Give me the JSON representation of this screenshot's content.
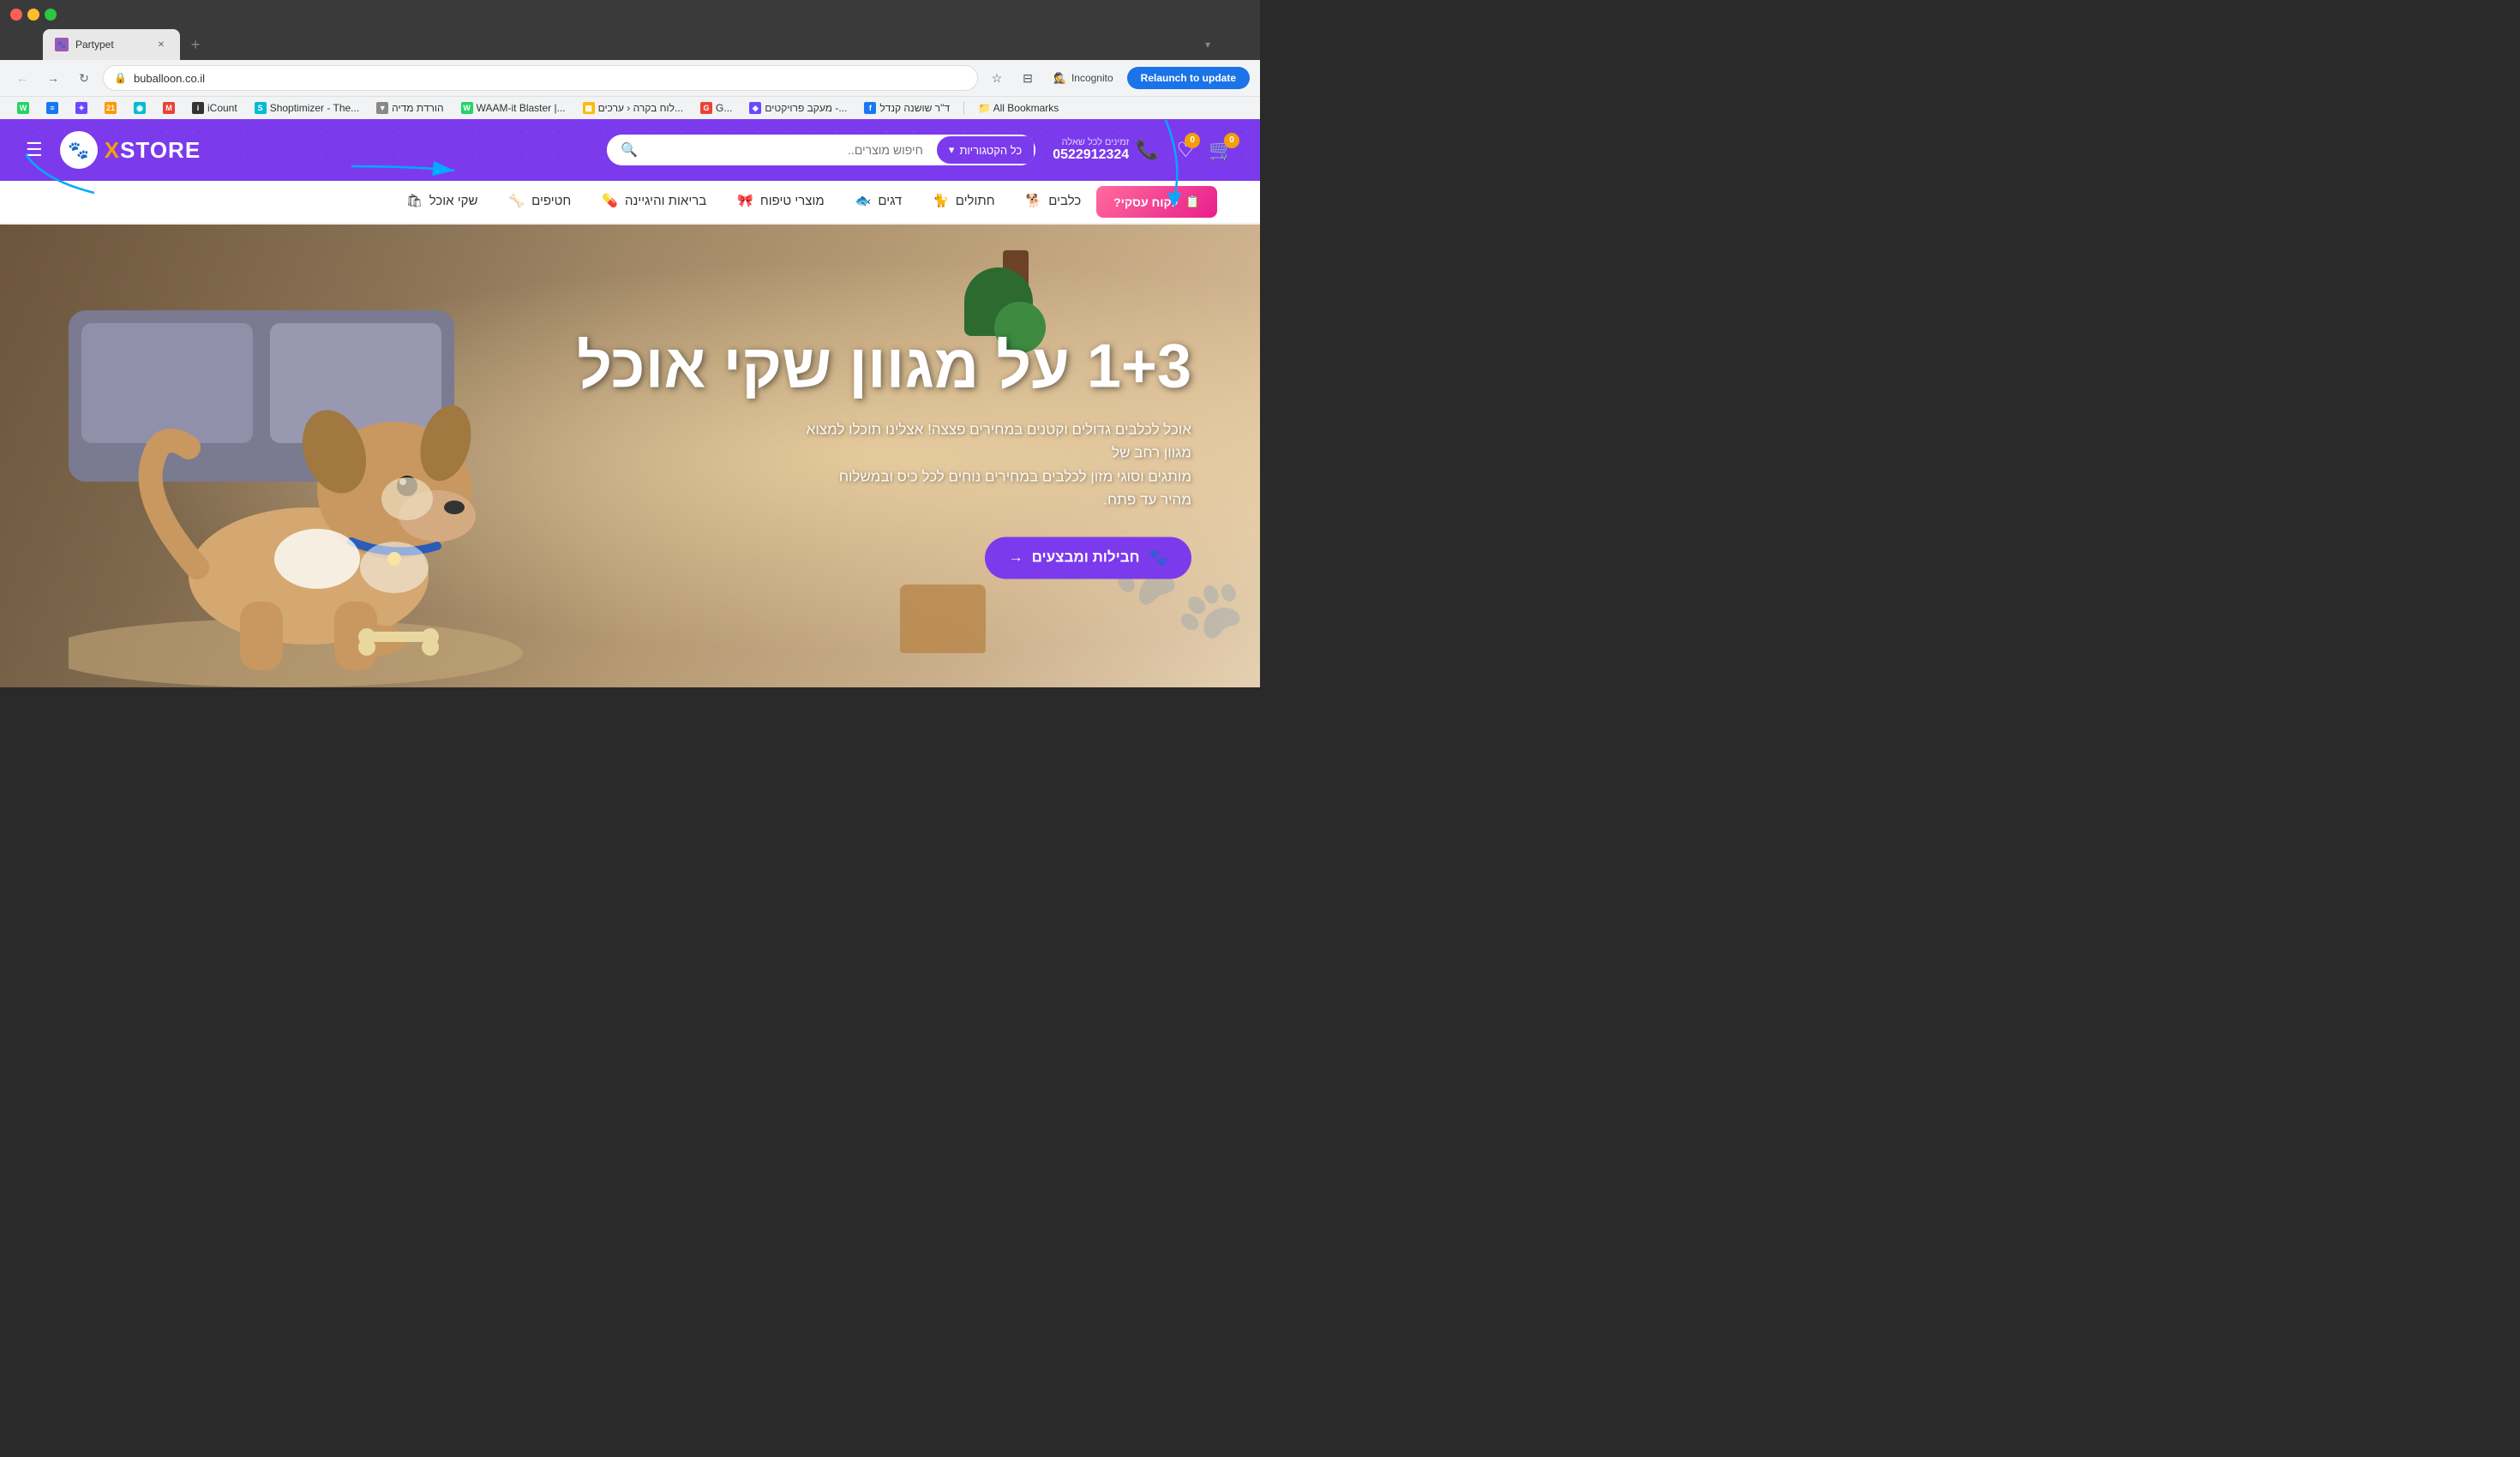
{
  "browser": {
    "tab_title": "Partypet",
    "url": "buballoon.co.il",
    "relaunch_btn": "Relaunch to update",
    "incognito_label": "Incognito",
    "new_tab_icon": "+",
    "back_icon": "←",
    "forward_icon": "→",
    "refresh_icon": "↻",
    "star_icon": "☆",
    "profile_icon": "👤"
  },
  "bookmarks": [
    {
      "id": "whatsapp",
      "label": "",
      "icon": "W",
      "color": "bm-green"
    },
    {
      "id": "docs",
      "label": "",
      "icon": "≡",
      "color": "bm-blue"
    },
    {
      "id": "ext1",
      "label": "",
      "icon": "✦",
      "color": "bm-purple"
    },
    {
      "id": "calendar",
      "label": "",
      "icon": "21",
      "color": "bm-orange"
    },
    {
      "id": "ext2",
      "label": "",
      "icon": "◉",
      "color": "bm-teal"
    },
    {
      "id": "gmail",
      "label": "",
      "icon": "M",
      "color": "bm-red"
    },
    {
      "id": "icount",
      "label": "iCount",
      "icon": "i",
      "color": "bm-dark"
    },
    {
      "id": "shoptimizer",
      "label": "Shoptimizer - The...",
      "icon": "S",
      "color": "bm-teal"
    },
    {
      "id": "hordat",
      "label": "הורדת מדיה",
      "icon": "▼",
      "color": "bm-gray"
    },
    {
      "id": "waam",
      "label": "WAAM-it Blaster |...",
      "icon": "W",
      "color": "bm-green"
    },
    {
      "id": "luach",
      "label": "לוח בקרה ‹ ערכים...",
      "icon": "▦",
      "color": "bm-grid"
    },
    {
      "id": "google",
      "label": "G...",
      "icon": "G",
      "color": "bm-red"
    },
    {
      "id": "maakev",
      "label": "מעקב פרויקטים -...",
      "icon": "◈",
      "color": "bm-purple"
    },
    {
      "id": "facebook",
      "label": "ד\"ר שושנה קנדל",
      "icon": "f",
      "color": "bm-blue"
    },
    {
      "id": "all",
      "label": "All Bookmarks",
      "icon": "❯",
      "color": "bm-gray"
    }
  ],
  "site": {
    "logo_x": "X",
    "logo_store": "STORE",
    "search_placeholder": "חיפוש מוצרים..",
    "search_category": "כל הקטגוריות",
    "phone_label": "זמינים לכל שאלה",
    "phone_number": "0522912324",
    "cart_count": "0",
    "wishlist_count": "0",
    "nav_items": [
      {
        "label": "כלבים",
        "icon": "🐕"
      },
      {
        "label": "חתולים",
        "icon": "🐈"
      },
      {
        "label": "דגים",
        "icon": "🐟"
      },
      {
        "label": "מוצרי טיפוח",
        "icon": "🎀"
      },
      {
        "label": "בריאות והיגיינה",
        "icon": "💊"
      },
      {
        "label": "חטיפים",
        "icon": "🦴"
      },
      {
        "label": "שקי אוכל",
        "icon": "🛍"
      }
    ],
    "business_btn": "לקוח עסקי?",
    "hero_title": "1+3 על מגוון שקי אוכל",
    "hero_subtitle_line1": "אוכל לכלבים גדולים וקטנים במחירים פצצה! אצלינו תוכלו למצוא מגוון רחב של",
    "hero_subtitle_line2": "מותגים וסוגי מזון לכלבים במחירים נוחים לכל כיס ובמשלוח מהיר עד פתח.",
    "hero_cta": "חבילות ומבצעים",
    "hero_cta_icon": "→",
    "paw_icon": "🐾"
  }
}
